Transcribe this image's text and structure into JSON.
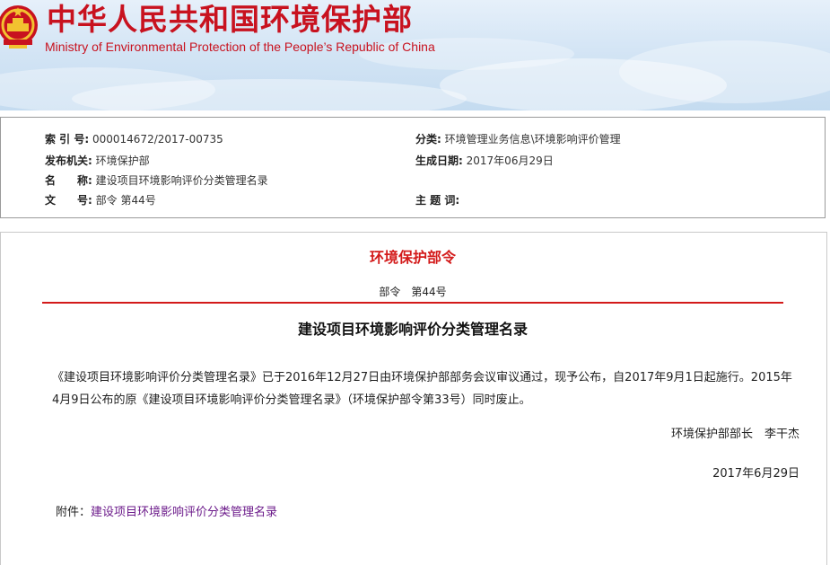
{
  "header": {
    "title": "中华人民共和国环境保护部",
    "subtitle": "Ministry of Environmental Protection of the People’s Republic of China"
  },
  "meta": {
    "index_label": "索 引 号:",
    "index_value": "000014672/2017-00735",
    "category_label": "分类:",
    "category_value": "环境管理业务信息\\环境影响评价管理",
    "issuer_label": "发布机关:",
    "issuer_value": "环境保护部",
    "date_label": "生成日期:",
    "date_value": "2017年06月29日",
    "name_label": "名　　称:",
    "name_value": "建设项目环境影响评价分类管理名录",
    "doc_no_label": "文　　号:",
    "doc_no_value": "部令 第44号",
    "keywords_label": "主 题 词:",
    "keywords_value": ""
  },
  "document": {
    "heading": "环境保护部令",
    "number": "部令　第44号",
    "title": "建设项目环境影响评价分类管理名录",
    "body": "《建设项目环境影响评价分类管理名录》已于2016年12月27日由环境保护部部务会议审议通过，现予公布，自2017年9月1日起施行。2015年4月9日公布的原《建设项目环境影响评价分类管理名录》（环境保护部令第33号）同时废止。",
    "signer": "环境保护部部长　李干杰",
    "sign_date": "2017年6月29日",
    "attachment_label": "附件：",
    "attachment_link": "建设项目环境影响评价分类管理名录"
  },
  "colors": {
    "brand_red": "#c8121f",
    "heading_red": "#d31a1a",
    "link_purple": "#6b1a8a"
  }
}
